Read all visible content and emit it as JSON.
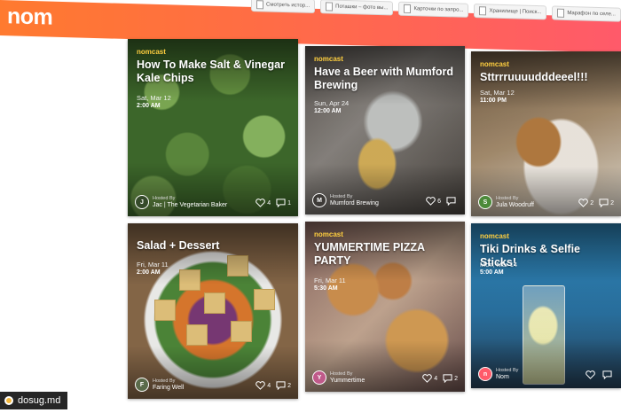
{
  "app": {
    "logo": "nom",
    "bookmarks": [
      "Смотреть истор...",
      "Поташки – фото вы...",
      "Карточки по запро...",
      "Хранилище | Поиск...",
      "Марафон по селе..."
    ]
  },
  "cards": [
    {
      "badge": "nomcast",
      "title": "How To Make Salt & Vinegar Kale Chips",
      "date": "Sat, Mar 12",
      "time": "2:00 AM",
      "host_label": "Hosted By",
      "host_name": "Jac | The Vegetarian Baker",
      "likes": "4",
      "comments": "1",
      "avatar_initial": "J"
    },
    {
      "badge": "nomcast",
      "title": "Have a Beer with Mumford Brewing",
      "date": "Sun, Apr 24",
      "time": "12:00 AM",
      "host_label": "Hosted By",
      "host_name": "Mumford Brewing",
      "likes": "6",
      "comments": "",
      "avatar_initial": "M"
    },
    {
      "badge": "nomcast",
      "title": "Sttrrruuuudddeeel!!!",
      "date": "Sat, Mar 12",
      "time": "11:00 PM",
      "host_label": "Hosted By",
      "host_name": "Jula Woodruff",
      "likes": "2",
      "comments": "2",
      "avatar_initial": "S"
    },
    {
      "badge": "",
      "title": "Salad + Dessert",
      "date": "Fri, Mar 11",
      "time": "2:00 AM",
      "host_label": "Hosted By",
      "host_name": "Faring Well",
      "likes": "4",
      "comments": "2",
      "avatar_initial": "F"
    },
    {
      "badge": "nomcast",
      "title": "YUMMERTIME PIZZA PARTY",
      "date": "Fri, Mar 11",
      "time": "5:30 AM",
      "host_label": "Hosted By",
      "host_name": "Yummertime",
      "likes": "4",
      "comments": "2",
      "avatar_initial": "Y"
    },
    {
      "badge": "nomcast",
      "title": "Tiki Drinks & Selfie Sticks!",
      "date": "Mon, Mar 14",
      "time": "5:00 AM",
      "host_label": "Hosted By",
      "host_name": "Nom",
      "likes": "",
      "comments": "",
      "avatar_initial": "n"
    }
  ],
  "watermark": "dosug.md",
  "colors": {
    "header_start": "#ff7a2f",
    "header_end": "#ff5a6a",
    "badge": "#ffcf3f"
  }
}
